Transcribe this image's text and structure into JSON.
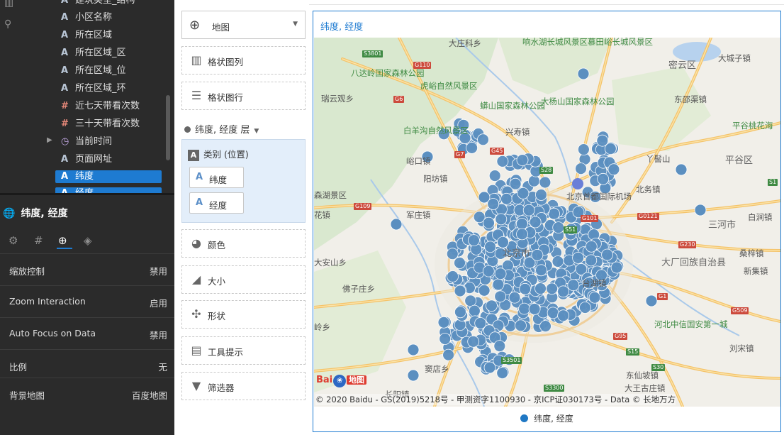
{
  "fields": [
    {
      "icon": "A",
      "label": "建筑类型_结构",
      "type": "text"
    },
    {
      "icon": "A",
      "label": "小区名称",
      "type": "text"
    },
    {
      "icon": "A",
      "label": "所在区域",
      "type": "text"
    },
    {
      "icon": "A",
      "label": "所在区域_区",
      "type": "text"
    },
    {
      "icon": "A",
      "label": "所在区域_位",
      "type": "text"
    },
    {
      "icon": "A",
      "label": "所在区域_环",
      "type": "text"
    },
    {
      "icon": "#",
      "label": "近七天带看次数",
      "type": "number"
    },
    {
      "icon": "#",
      "label": "三十天带看次数",
      "type": "number"
    },
    {
      "icon": "◷",
      "label": "当前时间",
      "type": "time"
    },
    {
      "icon": "A",
      "label": "页面网址",
      "type": "text"
    },
    {
      "icon": "A",
      "label": "纬度",
      "type": "text"
    },
    {
      "icon": "A",
      "label": "经度",
      "type": "text"
    }
  ],
  "properties": {
    "title": "纬度, 经度",
    "rows": [
      {
        "label": "缩放控制",
        "value": "禁用"
      },
      {
        "label": "Zoom Interaction",
        "value": "启用"
      },
      {
        "label": "Auto Focus on Data",
        "value": "禁用"
      },
      {
        "label": "比例",
        "value": "无"
      },
      {
        "label": "背景地图",
        "value": "百度地图"
      }
    ]
  },
  "shelves": {
    "map_type": "地图",
    "columns": "格状图列",
    "rows": "格状图行",
    "layer_header": "纬度, 经度 层",
    "layer_box_title": "类别 (位置)",
    "latitude": "纬度",
    "longitude": "经度",
    "color": "颜色",
    "size": "大小",
    "shape": "形状",
    "tooltip": "工具提示",
    "filter": "筛选器"
  },
  "chart": {
    "title": "纬度, 经度",
    "legend_label": "纬度, 经度",
    "point_color": "#5b8fc0",
    "copyright": "© 2020 Baidu - GS(2019)5218号 - 甲测资字1100930 - 京ICP证030173号 - Data © 长地万方",
    "logo_text_1": "Bai",
    "logo_text_2": "地图",
    "places": [
      {
        "name": "大庄科乡",
        "cls": ""
      },
      {
        "name": "响水湖长城风景区",
        "cls": "green"
      },
      {
        "name": "慕田峪长城风景区",
        "cls": "green"
      },
      {
        "name": "大城子镇",
        "cls": ""
      },
      {
        "name": "密云区",
        "cls": "big"
      },
      {
        "name": "八达岭国家森林公园",
        "cls": "green"
      },
      {
        "name": "虎峪自然风景区",
        "cls": "green"
      },
      {
        "name": "瑞云观乡",
        "cls": ""
      },
      {
        "name": "蟒山国家森林公园",
        "cls": "green"
      },
      {
        "name": "大杨山国家森林公园",
        "cls": "green"
      },
      {
        "name": "东邵渠镇",
        "cls": ""
      },
      {
        "name": "平谷桃花海",
        "cls": "green"
      },
      {
        "name": "白羊沟自然风景区",
        "cls": "green"
      },
      {
        "name": "兴寿镇",
        "cls": ""
      },
      {
        "name": "丫髻山",
        "cls": ""
      },
      {
        "name": "峪口镇",
        "cls": ""
      },
      {
        "name": "阳坊镇",
        "cls": ""
      },
      {
        "name": "平谷区",
        "cls": "big"
      },
      {
        "name": "北京首都国际机场",
        "cls": ""
      },
      {
        "name": "北务镇",
        "cls": ""
      },
      {
        "name": "森湖景区",
        "cls": ""
      },
      {
        "name": "军庄镇",
        "cls": ""
      },
      {
        "name": "三河市",
        "cls": "big"
      },
      {
        "name": "桑梓镇",
        "cls": ""
      },
      {
        "name": "新集镇",
        "cls": ""
      },
      {
        "name": "大厂回族自治县",
        "cls": "big"
      },
      {
        "name": "台湖镇",
        "cls": ""
      },
      {
        "name": "佛子庄乡",
        "cls": ""
      },
      {
        "name": "岭乡",
        "cls": ""
      },
      {
        "name": "河北中信国安第一城",
        "cls": "green"
      },
      {
        "name": "刘宋镇",
        "cls": ""
      },
      {
        "name": "窦店乡",
        "cls": ""
      },
      {
        "name": "长阳镇",
        "cls": ""
      },
      {
        "name": "大王古庄镇",
        "cls": ""
      },
      {
        "name": "大安山乡",
        "cls": ""
      },
      {
        "name": "东仙坡镇",
        "cls": ""
      },
      {
        "name": "北京市",
        "cls": "big"
      },
      {
        "name": "白涧镇",
        "cls": ""
      },
      {
        "name": "花镇",
        "cls": ""
      }
    ],
    "road_badges": [
      "S3801",
      "G110",
      "G6",
      "G7",
      "G45",
      "S28",
      "G101",
      "S51",
      "G0121",
      "G230",
      "G109",
      "S1",
      "G1",
      "G509",
      "G95",
      "S15",
      "S30",
      "S3501",
      "S3300"
    ]
  }
}
